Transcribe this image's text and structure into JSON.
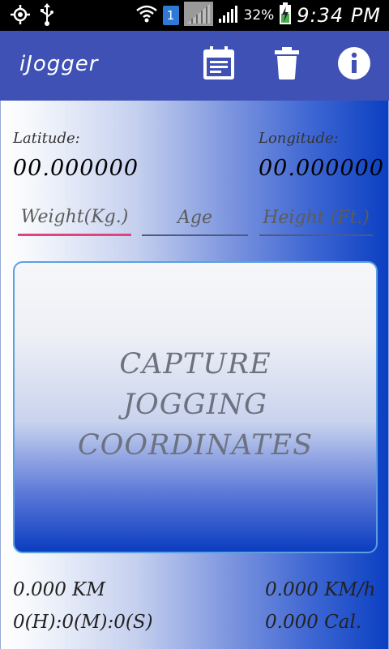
{
  "status_bar": {
    "sim_slot": "1",
    "battery": "32%",
    "time": "9:34 PM"
  },
  "app_bar": {
    "title": "iJogger",
    "icons": [
      "calendar-notes-icon",
      "trash-icon",
      "info-icon"
    ]
  },
  "location": {
    "latitude_label": "Latitude:",
    "latitude_value": "00.000000",
    "longitude_label": "Longitude:",
    "longitude_value": "00.000000"
  },
  "inputs": {
    "weight_placeholder": "Weight(Kg.)",
    "age_placeholder": "Age",
    "height_placeholder": "Height (Ft.)"
  },
  "capture": {
    "label": "CAPTURE JOGGING COORDINATES"
  },
  "stats": {
    "distance": "0.000 KM",
    "duration": "0(H):0(M):0(S)",
    "speed": "0.000 KM/h",
    "calories": "0.000 Cal."
  },
  "colors": {
    "app_bar": "#3f51b5",
    "accent": "#e3427e",
    "gradient_end": "#0b3fc2"
  }
}
